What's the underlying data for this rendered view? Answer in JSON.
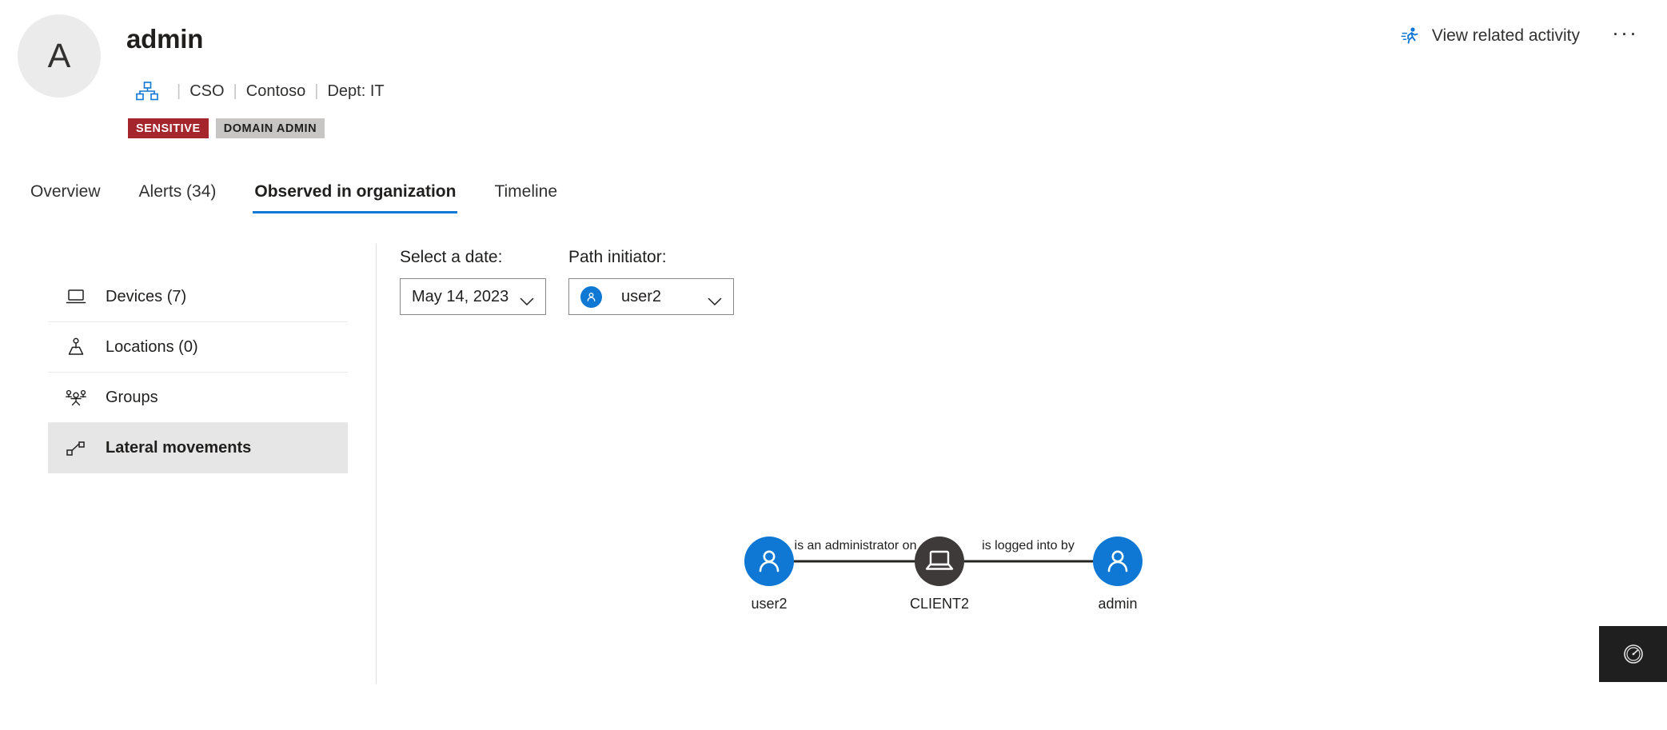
{
  "header": {
    "avatar_initial": "A",
    "entity_name": "admin",
    "org_icon": "org-hierarchy-icon",
    "meta": [
      "CSO",
      "Contoso",
      "Dept: IT"
    ],
    "badges": [
      {
        "label": "SENSITIVE",
        "color": "#a4262c",
        "text_color": "#ffffff"
      },
      {
        "label": "DOMAIN ADMIN",
        "color": "#c8c6c4",
        "text_color": "#201f1e"
      }
    ],
    "related_activity_label": "View related activity",
    "related_activity_icon": "running-person-icon",
    "overflow_label": "···"
  },
  "tabs": [
    {
      "label": "Overview",
      "active": false
    },
    {
      "label": "Alerts (34)",
      "active": false
    },
    {
      "label": "Observed in organization",
      "active": true
    },
    {
      "label": "Timeline",
      "active": false
    }
  ],
  "sidebar": {
    "items": [
      {
        "label": "Devices (7)",
        "icon": "laptop-icon",
        "active": false
      },
      {
        "label": "Locations (0)",
        "icon": "location-person-icon",
        "active": false
      },
      {
        "label": "Groups",
        "icon": "people-group-icon",
        "active": false
      },
      {
        "label": "Lateral movements",
        "icon": "lateral-movement-icon",
        "active": true
      }
    ]
  },
  "filters": {
    "date": {
      "label": "Select a date:",
      "value": "May 14, 2023",
      "chevron_icon": "chevron-down-icon"
    },
    "initiator": {
      "label": "Path initiator:",
      "value": "user2",
      "avatar_icon": "person-icon",
      "chevron_icon": "chevron-down-icon"
    }
  },
  "graph": {
    "nodes": [
      {
        "id": "user2",
        "label": "user2",
        "type": "user",
        "color": "#0f78d4",
        "icon": "person-icon"
      },
      {
        "id": "CLIENT2",
        "label": "CLIENT2",
        "type": "device",
        "color": "#3d3a39",
        "icon": "laptop-icon"
      },
      {
        "id": "admin",
        "label": "admin",
        "type": "user",
        "color": "#0f78d4",
        "icon": "person-icon"
      }
    ],
    "edges": [
      {
        "from": "user2",
        "to": "CLIENT2",
        "label": "is an administrator on"
      },
      {
        "from": "CLIENT2",
        "to": "admin",
        "label": "is logged into by"
      }
    ]
  },
  "corner_widget": {
    "icon": "gauge-icon",
    "background": "#1f1f1f"
  },
  "accent_color": "#0f78d4"
}
